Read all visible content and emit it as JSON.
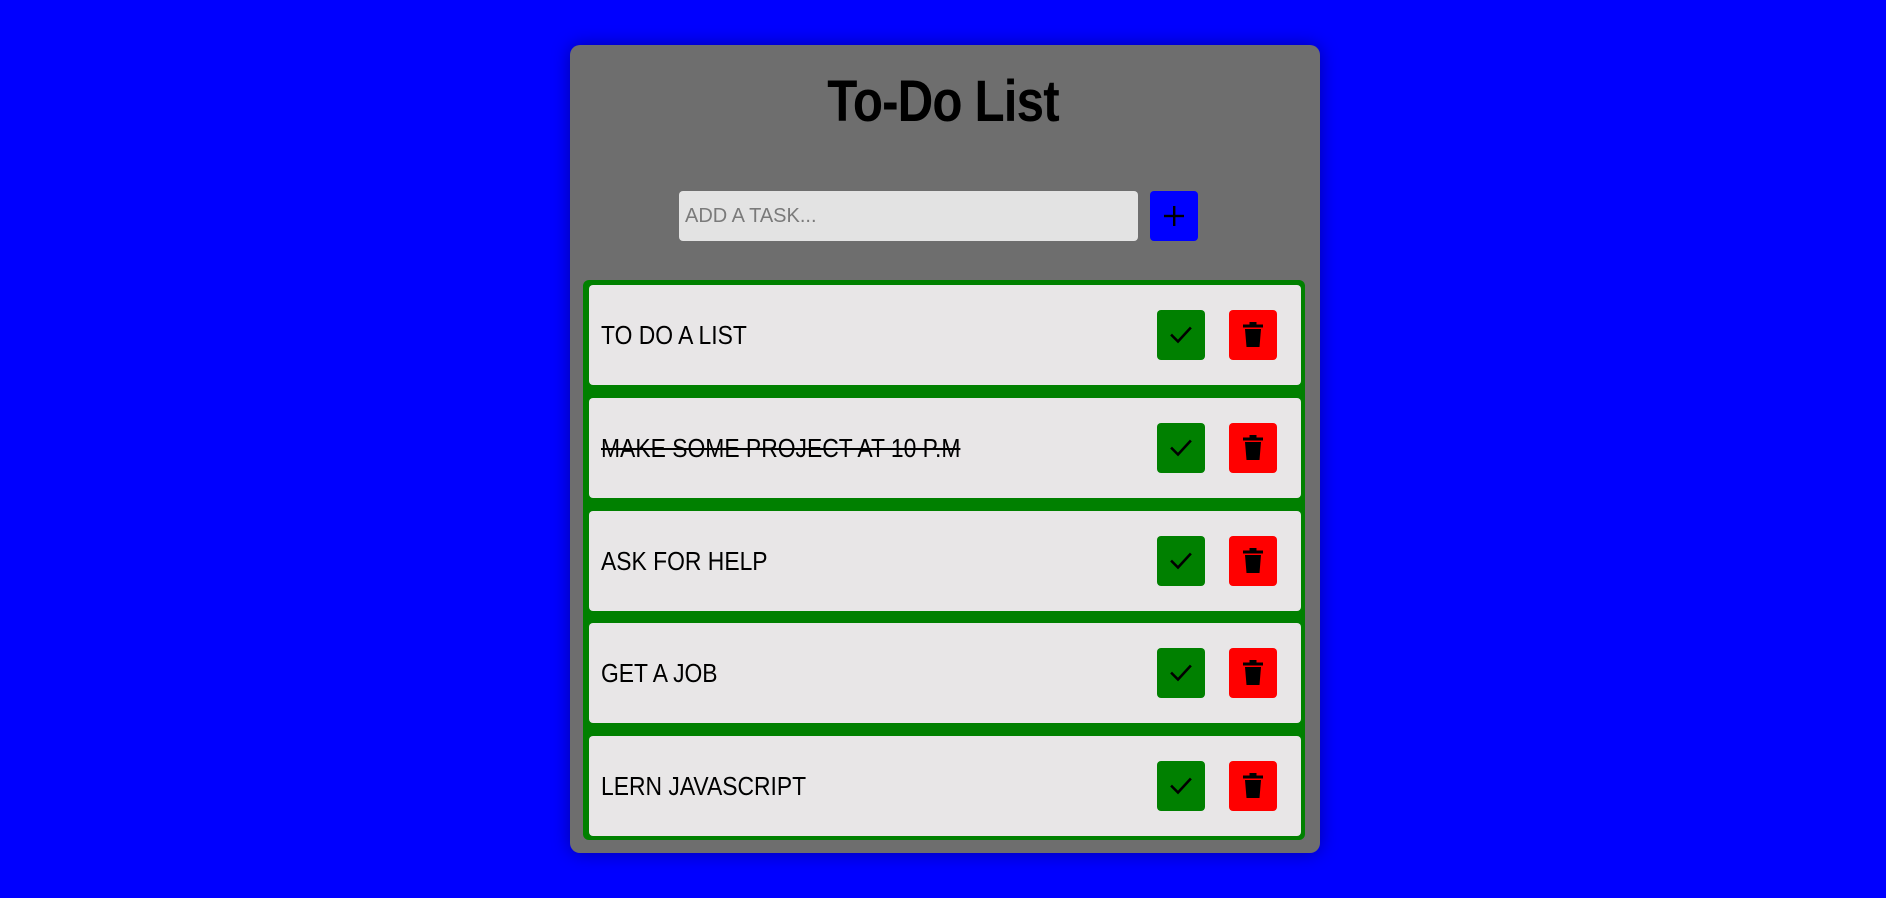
{
  "app": {
    "title": "To-Do List"
  },
  "input": {
    "placeholder": "ADD A TASK...",
    "value": ""
  },
  "add_button": {
    "icon": "plus-icon"
  },
  "tasks": [
    {
      "text": "TO DO A LIST",
      "completed": false
    },
    {
      "text": "MAKE SOME PROJECT AT 10 P.M",
      "completed": true
    },
    {
      "text": "ASK FOR HELP",
      "completed": false
    },
    {
      "text": "GET A JOB",
      "completed": false
    },
    {
      "text": "LERN JAVASCRIPT",
      "completed": false
    }
  ],
  "row_buttons": {
    "complete_icon": "check-icon",
    "delete_icon": "trash-icon"
  },
  "colors": {
    "page_background": "#0000ff",
    "card_background": "#6e6e6e",
    "list_frame": "#008000",
    "row_background": "#e8e6e7",
    "check_button": "#008000",
    "delete_button": "#ff0000",
    "add_button": "#0000ff"
  }
}
